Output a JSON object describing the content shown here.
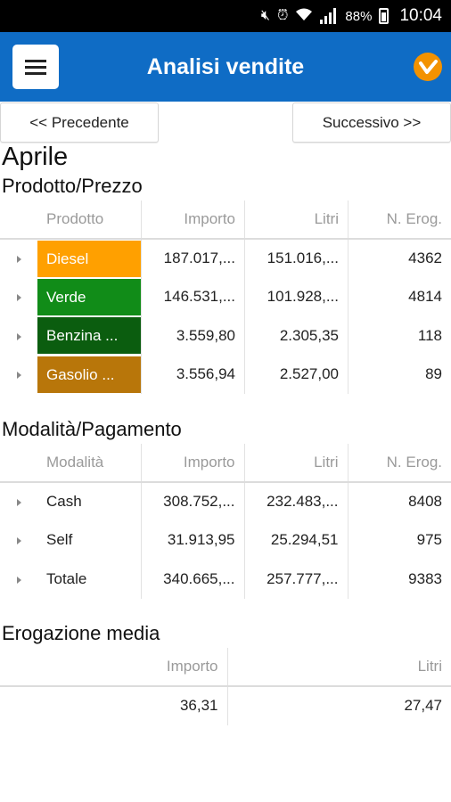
{
  "status_bar": {
    "battery": "88%",
    "time": "10:04"
  },
  "app_bar": {
    "title": "Analisi vendite"
  },
  "nav": {
    "prev": "<< Precedente",
    "next": "Successivo >>"
  },
  "period": "Aprile",
  "prodotto_section": {
    "title": "Prodotto/Prezzo",
    "headers": [
      "Prodotto",
      "Importo",
      "Litri",
      "N. Erog."
    ],
    "rows": [
      {
        "name": "Diesel",
        "color": "#ffa000",
        "importo": "187.017,...",
        "litri": "151.016,...",
        "nerog": "4362"
      },
      {
        "name": "Verde",
        "color": "#118c18",
        "importo": "146.531,...",
        "litri": "101.928,...",
        "nerog": "4814"
      },
      {
        "name": "Benzina ...",
        "color": "#0b5d0f",
        "importo": "3.559,80",
        "litri": "2.305,35",
        "nerog": "118"
      },
      {
        "name": "Gasolio ...",
        "color": "#b8760a",
        "importo": "3.556,94",
        "litri": "2.527,00",
        "nerog": "89"
      }
    ]
  },
  "modalita_section": {
    "title": "Modalità/Pagamento",
    "headers": [
      "Modalità",
      "Importo",
      "Litri",
      "N. Erog."
    ],
    "rows": [
      {
        "name": "Cash",
        "importo": "308.752,...",
        "litri": "232.483,...",
        "nerog": "8408"
      },
      {
        "name": "Self",
        "importo": "31.913,95",
        "litri": "25.294,51",
        "nerog": "975"
      },
      {
        "name": "Totale",
        "importo": "340.665,...",
        "litri": "257.777,...",
        "nerog": "9383"
      }
    ]
  },
  "erogazione_section": {
    "title": "Erogazione media",
    "headers": [
      "Importo",
      "Litri"
    ],
    "values": {
      "importo": "36,31",
      "litri": "27,47"
    }
  }
}
